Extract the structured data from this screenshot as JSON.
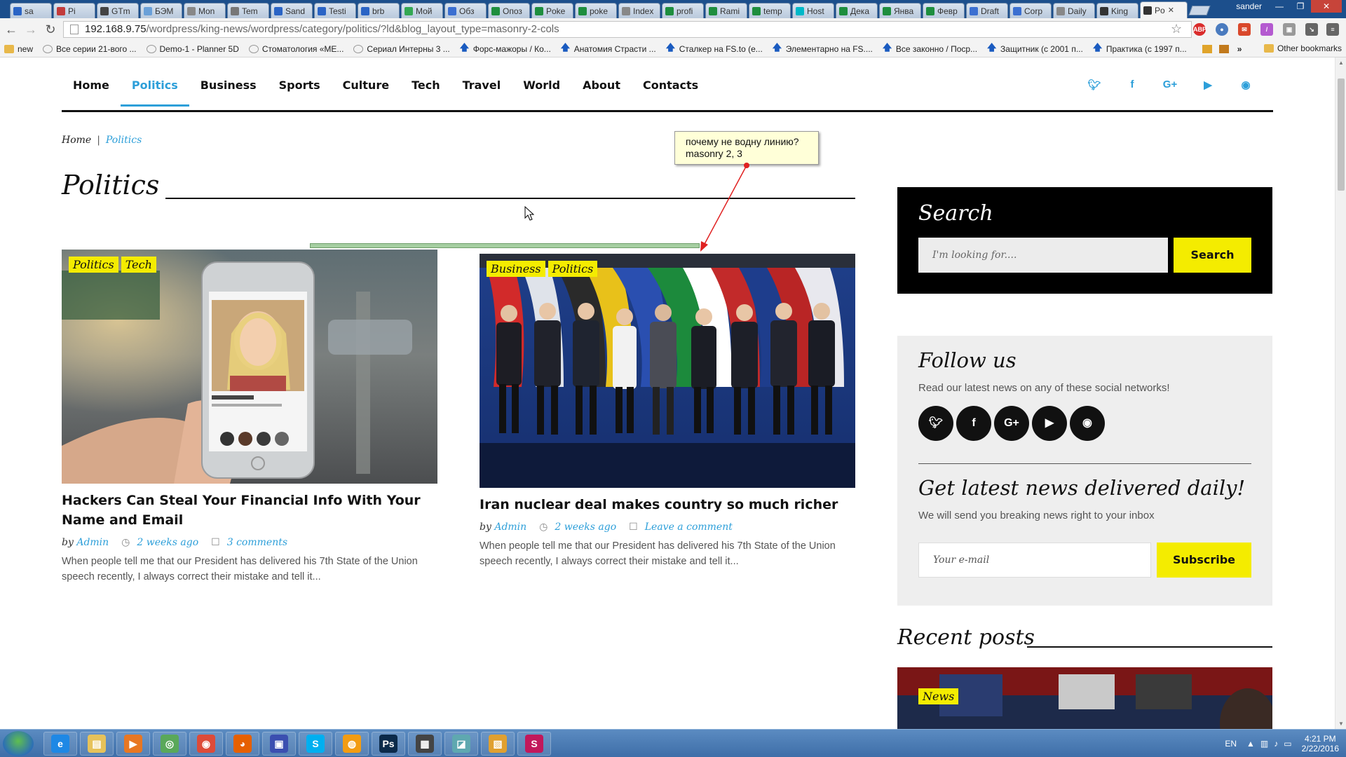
{
  "browser": {
    "tabs": [
      {
        "label": "sa",
        "color": "#2a64c5"
      },
      {
        "label": "Pi",
        "color": "#c23b3b"
      },
      {
        "label": "GTm",
        "color": "#444444"
      },
      {
        "label": "БЭМ",
        "color": "#6aa0d8"
      },
      {
        "label": "Mon",
        "color": "#888888"
      },
      {
        "label": "Tem",
        "color": "#777777"
      },
      {
        "label": "Sand",
        "color": "#2a64c5"
      },
      {
        "label": "Testi",
        "color": "#2a64c5"
      },
      {
        "label": "brb",
        "color": "#2a64c5"
      },
      {
        "label": "Мой",
        "color": "#34a853"
      },
      {
        "label": "Обз",
        "color": "#3b6fd1"
      },
      {
        "label": "Опоз",
        "color": "#1e8e3e"
      },
      {
        "label": "Poke",
        "color": "#1e8e3e"
      },
      {
        "label": "poke",
        "color": "#1e8e3e"
      },
      {
        "label": "Index",
        "color": "#888888"
      },
      {
        "label": "profi",
        "color": "#1e8e3e"
      },
      {
        "label": "Rami",
        "color": "#1e8e3e"
      },
      {
        "label": "temp",
        "color": "#1e8e3e"
      },
      {
        "label": "Host",
        "color": "#00b8c8"
      },
      {
        "label": "Дека",
        "color": "#1e8e3e"
      },
      {
        "label": "Янва",
        "color": "#1e8e3e"
      },
      {
        "label": "Февр",
        "color": "#1e8e3e"
      },
      {
        "label": "Draft",
        "color": "#3b6fd1"
      },
      {
        "label": "Corp",
        "color": "#3b6fd1"
      },
      {
        "label": "Daily",
        "color": "#888888"
      },
      {
        "label": "King",
        "color": "#333333"
      }
    ],
    "active_tab": {
      "label": "Po",
      "close": "✕"
    },
    "user": "sander",
    "url_host": "192.168.9.75",
    "url_path": "/wordpress/king-news/wordpress/category/politics/?ld&blog_layout_type=masonry-2-cols",
    "bookmarks": [
      {
        "label": "new",
        "kind": "folder"
      },
      {
        "label": "Все серии 21-вого ...",
        "kind": "page"
      },
      {
        "label": "Demo-1 - Planner 5D",
        "kind": "page"
      },
      {
        "label": "Стоматология «МЕ...",
        "kind": "page"
      },
      {
        "label": "Сериал Интерны 3 ...",
        "kind": "page"
      },
      {
        "label": "Форс-мажоры / Ко...",
        "kind": "arrow"
      },
      {
        "label": "Анатомия Страсти ...",
        "kind": "arrow"
      },
      {
        "label": "Сталкер на FS.to (е...",
        "kind": "arrow"
      },
      {
        "label": "Элементарно на FS....",
        "kind": "arrow"
      },
      {
        "label": "Все законно / Поср...",
        "kind": "arrow"
      },
      {
        "label": "Защитник (с 2001 п...",
        "kind": "arrow"
      },
      {
        "label": "Практика (с 1997 п...",
        "kind": "arrow"
      }
    ],
    "more": "»",
    "other_bookmarks": "Other bookmarks"
  },
  "site": {
    "menu": [
      "Home",
      "Politics",
      "Business",
      "Sports",
      "Culture",
      "Tech",
      "Travel",
      "World",
      "About",
      "Contacts"
    ],
    "active_menu": "Politics",
    "social_icons": [
      "twitter-icon",
      "facebook-icon",
      "google-plus-icon",
      "youtube-icon",
      "rss-icon"
    ],
    "breadcrumb": {
      "home": "Home",
      "sep": "|",
      "current": "Politics"
    },
    "page_title": "Politics",
    "annotation": {
      "line1": "почему не водну линию?",
      "line2": "masonry 2, 3"
    },
    "posts": [
      {
        "tags": [
          "Politics",
          "Tech"
        ],
        "title": "Hackers Can Steal Your Financial Info With Your Name and Email",
        "by": "by",
        "author": "Admin",
        "date": "2 weeks ago",
        "comments": "3 comments",
        "excerpt": "When people tell me that our President has delivered his 7th State of the Union speech recently, I always correct their mistake and tell it...",
        "image": "hand holding smartphone with dating app profile"
      },
      {
        "tags": [
          "Business",
          "Politics"
        ],
        "title": "Iran nuclear deal makes country so much richer",
        "by": "by",
        "author": "Admin",
        "date": "2 weeks ago",
        "comments": "Leave a comment",
        "excerpt": "When people tell me that our President has delivered his 7th State of the Union speech recently, I always correct their mistake and tell it...",
        "image": "group of diplomats standing in front of national flags"
      }
    ],
    "search_widget": {
      "title": "Search",
      "placeholder": "I'm looking for....",
      "button": "Search"
    },
    "follow_widget": {
      "title": "Follow us",
      "desc": "Read our latest news on any of these social networks!",
      "newsletter_title": "Get latest news delivered daily!",
      "newsletter_desc": "We will send you breaking news right to your inbox",
      "email_placeholder": "Your e-mail",
      "subscribe": "Subscribe"
    },
    "recent": {
      "title": "Recent posts",
      "tag": "News"
    },
    "colors": {
      "accent": "#2d9fd9",
      "tag_yellow": "#f4ec00"
    }
  },
  "taskbar": {
    "apps": [
      "ie-icon",
      "explorer-icon",
      "media-player-icon",
      "network-icon",
      "chrome-icon",
      "firefox-icon",
      "save-icon",
      "skype-icon",
      "app-orange-icon",
      "photoshop-icon",
      "app-dark-icon",
      "app-teal-icon",
      "app-folder-icon",
      "app-s-icon"
    ],
    "lang": "EN",
    "time": "4:21 PM",
    "date": "2/22/2016"
  }
}
